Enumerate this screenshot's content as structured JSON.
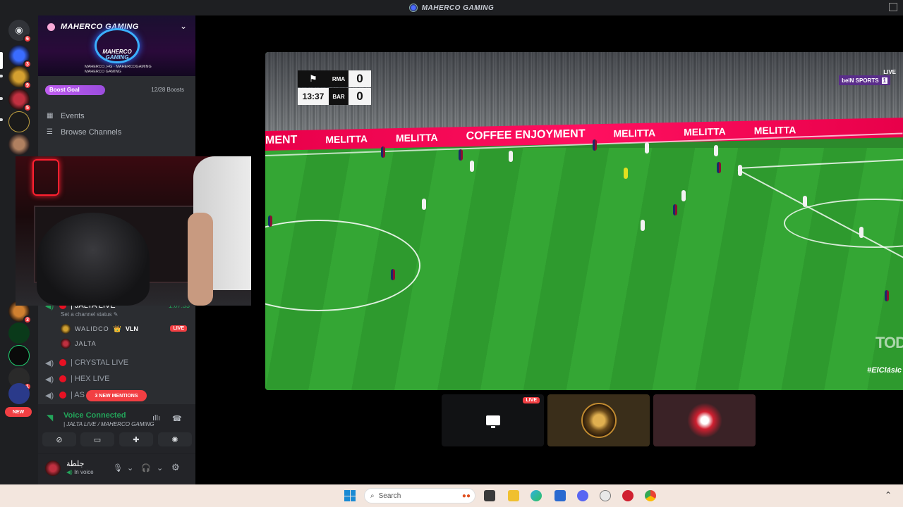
{
  "window": {
    "title": "MAHERCO GAMING"
  },
  "servers": {
    "badges": [
      "6",
      "3",
      "9",
      "5",
      "3",
      "1"
    ],
    "new_label": "NEW"
  },
  "server_header": {
    "name": "MAHERCO GAMING",
    "banner_logo_line1": "MAHERCO",
    "banner_logo_line2": "GAMING",
    "socials": [
      "MAHERCO_HG",
      "MAHERCOGAMING",
      "MAHERCO GAMING"
    ]
  },
  "boost": {
    "label": "Boost Goal",
    "count": "12/28 Boosts",
    "progress_fraction": 0.43
  },
  "nav": {
    "events": "Events",
    "browse": "Browse Channels"
  },
  "voice_channels": {
    "active": {
      "name": "| JALTA LIVE",
      "duration": "1:07:33",
      "status": "Set a channel status"
    },
    "users": [
      {
        "name": "WALIDCO",
        "tag": "VLN",
        "live": "LIVE"
      },
      {
        "name": "JALTA"
      }
    ],
    "others": [
      "| CRYSTAL LIVE",
      "| HEX LIVE",
      "| AS"
    ],
    "mentions": "3 NEW MENTIONS"
  },
  "voice_panel": {
    "title": "Voice Connected",
    "subtitle": "| JALTA LIVE / MAHERCO GAMING"
  },
  "user": {
    "name": "جلطة",
    "status": "In voice"
  },
  "stream": {
    "score": {
      "home": "RMA",
      "away": "BAR",
      "home_goals": "0",
      "away_goals": "0",
      "clock": "13:37"
    },
    "broadcaster": "beIN SPORTS",
    "channel_num": "1",
    "live": "LIVE",
    "ads": [
      "MENT",
      "MELITTA",
      "MELITTA",
      "COFFEE ENJOYMENT",
      "MELITTA",
      "MELITTA",
      "MELITTA"
    ],
    "watermark": "TOD",
    "hashtag": "#ElClásic"
  },
  "tiles": {
    "live": "LIVE"
  },
  "taskbar": {
    "search_placeholder": "Search"
  }
}
